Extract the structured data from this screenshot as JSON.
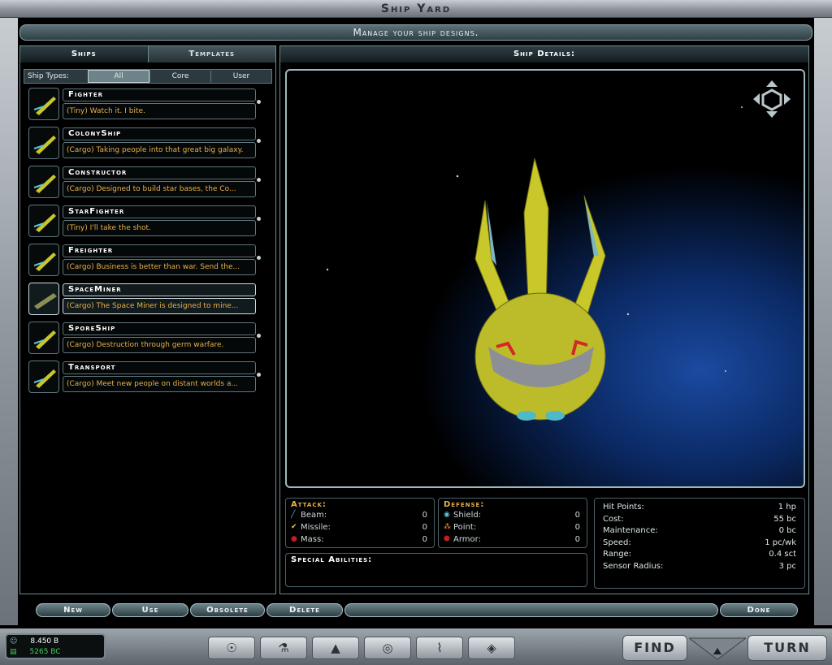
{
  "window": {
    "title": "Ship Yard",
    "subtitle": "Manage your ship designs."
  },
  "left_panel": {
    "tabs": [
      {
        "label": "Ships"
      },
      {
        "label": "Templates"
      }
    ],
    "ship_types_label": "Ship Types:",
    "filters": [
      {
        "label": "All"
      },
      {
        "label": "Core"
      },
      {
        "label": "User"
      }
    ],
    "ships": [
      {
        "name": "Fighter",
        "desc": "(Tiny) Watch it. I bite."
      },
      {
        "name": "ColonyShip",
        "desc": "(Cargo) Taking people into that great big galaxy."
      },
      {
        "name": "Constructor",
        "desc": "(Cargo) Designed to build star bases, the Co..."
      },
      {
        "name": "StarFighter",
        "desc": "(Tiny) I'll take the shot."
      },
      {
        "name": "Freighter",
        "desc": "(Cargo) Business is better than war. Send the..."
      },
      {
        "name": "SpaceMiner",
        "desc": "(Cargo) The Space Miner is designed to mine..."
      },
      {
        "name": "SporeShip",
        "desc": "(Cargo) Destruction through germ warfare."
      },
      {
        "name": "Transport",
        "desc": "(Cargo) Meet new people on distant worlds a..."
      }
    ]
  },
  "details": {
    "header": "Ship Details:",
    "attack": {
      "title": "Attack:",
      "rows": [
        {
          "label": "Beam:",
          "value": "0"
        },
        {
          "label": "Missile:",
          "value": "0"
        },
        {
          "label": "Mass:",
          "value": "0"
        }
      ]
    },
    "defense": {
      "title": "Defense:",
      "rows": [
        {
          "label": "Shield:",
          "value": "0"
        },
        {
          "label": "Point:",
          "value": "0"
        },
        {
          "label": "Armor:",
          "value": "0"
        }
      ]
    },
    "special_title": "Special Abilities:",
    "general": [
      {
        "label": "Hit Points:",
        "value": "1 hp"
      },
      {
        "label": "Cost:",
        "value": "55 bc"
      },
      {
        "label": "Maintenance:",
        "value": "0 bc"
      },
      {
        "label": "Speed:",
        "value": "1 pc/wk"
      },
      {
        "label": "Range:",
        "value": "0.4 sct"
      },
      {
        "label": "Sensor Radius:",
        "value": "3 pc"
      }
    ]
  },
  "commands": {
    "new": "New",
    "use": "Use",
    "obsolete": "Obsolete",
    "delete": "Delete",
    "done": "Done"
  },
  "status": {
    "population": "8.450 B",
    "credits": "5265 BC"
  },
  "bottom": {
    "find": "FIND",
    "turn": "TURN",
    "nav_icons": [
      "planets-icon",
      "research-icon",
      "government-icon",
      "races-icon",
      "graphs-icon",
      "shipyard-icon"
    ]
  },
  "colors": {
    "accent_gold": "#e6b04a",
    "frame_teal": "#6e8a90"
  }
}
